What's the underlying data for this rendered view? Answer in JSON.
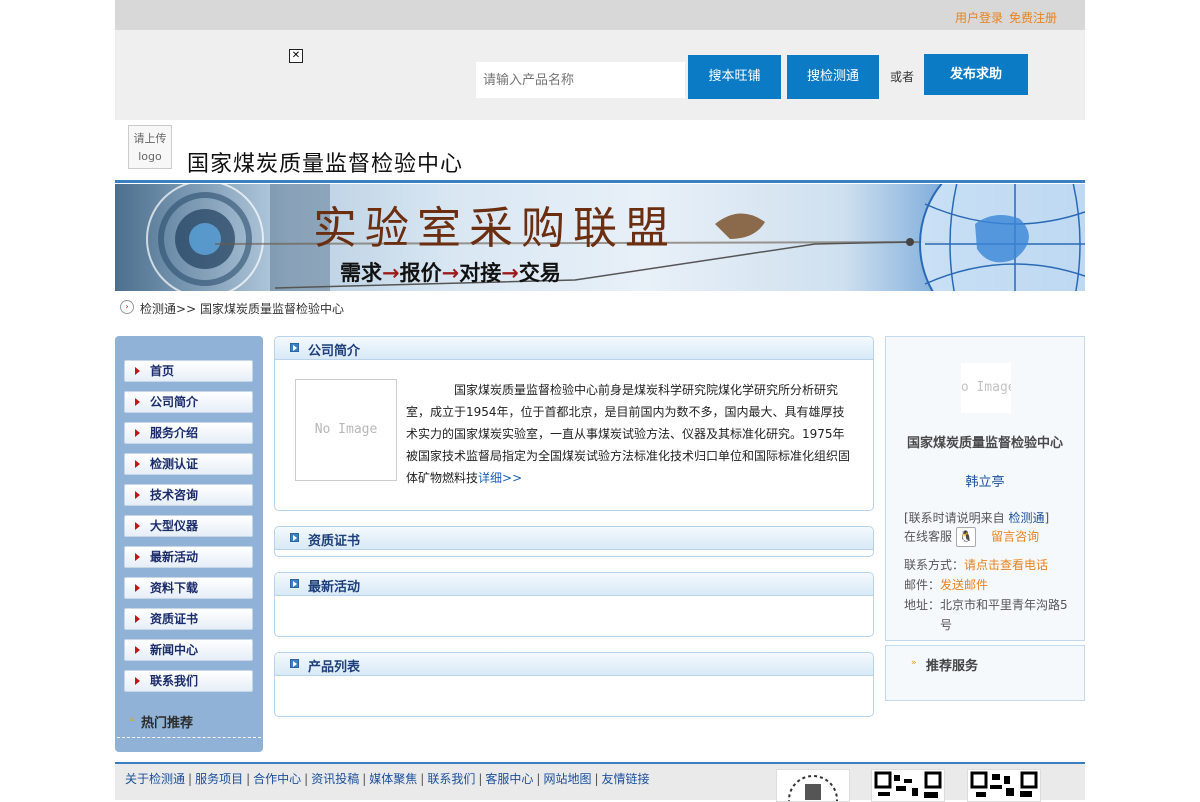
{
  "topbar": {
    "login": "用户登录",
    "register": "免费注册"
  },
  "search": {
    "placeholder": "请输入产品名称",
    "btn_shop": "搜本旺铺",
    "btn_test": "搜检测通",
    "or": "或者",
    "btn_publish": "发布求助"
  },
  "header": {
    "logo_text_line1": "请上传",
    "logo_text_line2": "logo",
    "company": "国家煤炭质量监督检验中心"
  },
  "banner": {
    "title": "实验室采购联盟",
    "subtitle": [
      "需求",
      "报价",
      "对接",
      "交易"
    ]
  },
  "breadcrumb": {
    "home": "检测通",
    "sep": ">>",
    "current": "国家煤炭质量监督检验中心"
  },
  "nav": {
    "items": [
      "首页",
      "公司简介",
      "服务介绍",
      "检测认证",
      "技术咨询",
      "大型仪器",
      "最新活动",
      "资料下载",
      "资质证书",
      "新闻中心",
      "联系我们"
    ],
    "hot": "热门推荐"
  },
  "panels": {
    "intro_title": "公司简介",
    "no_image": "No Image",
    "intro_text": "国家煤炭质量监督检验中心前身是煤炭科学研究院煤化学研究所分析研究室，成立于1954年，位于首都北京，是目前国内为数不多，国内最大、具有雄厚技术实力的国家煤炭实验室，一直从事煤炭试验方法、仪器及其标准化研究。1975年被国家技术监督局指定为全国煤炭试验方法标准化技术归口单位和国际标准化组织固体矿物燃料技",
    "intro_more": "详细>>",
    "cert_title": "资质证书",
    "news_title": "最新活动",
    "products_title": "产品列表"
  },
  "profile": {
    "img_text": "No Image",
    "name": "国家煤炭质量监督检验中心",
    "person": "韩立亭",
    "note_prefix": "[联系时请说明来自",
    "note_link": "检测通",
    "note_suffix": "]",
    "online_label": "在线客服",
    "message": "留言咨询",
    "contact_label": "联系方式：",
    "contact_value": "请点击查看电话",
    "mail_label": "邮件：",
    "mail_value": "发送邮件",
    "address_label": "地址：",
    "address_value_line1": "北京市和平里青年沟路5",
    "address_value_line2": "号"
  },
  "recommend": {
    "title": "推荐服务"
  },
  "footer": {
    "links": [
      "关于检测通",
      "服务项目",
      "合作中心",
      "资讯投稿",
      "媒体聚焦",
      "联系我们",
      "客服中心",
      "网站地图",
      "友情链接"
    ]
  },
  "colors": {
    "accent": "#0a7bc4",
    "nav_bg": "#8fb2d6",
    "link_orange": "#e8821e",
    "title_blue": "#1d3f7a"
  }
}
